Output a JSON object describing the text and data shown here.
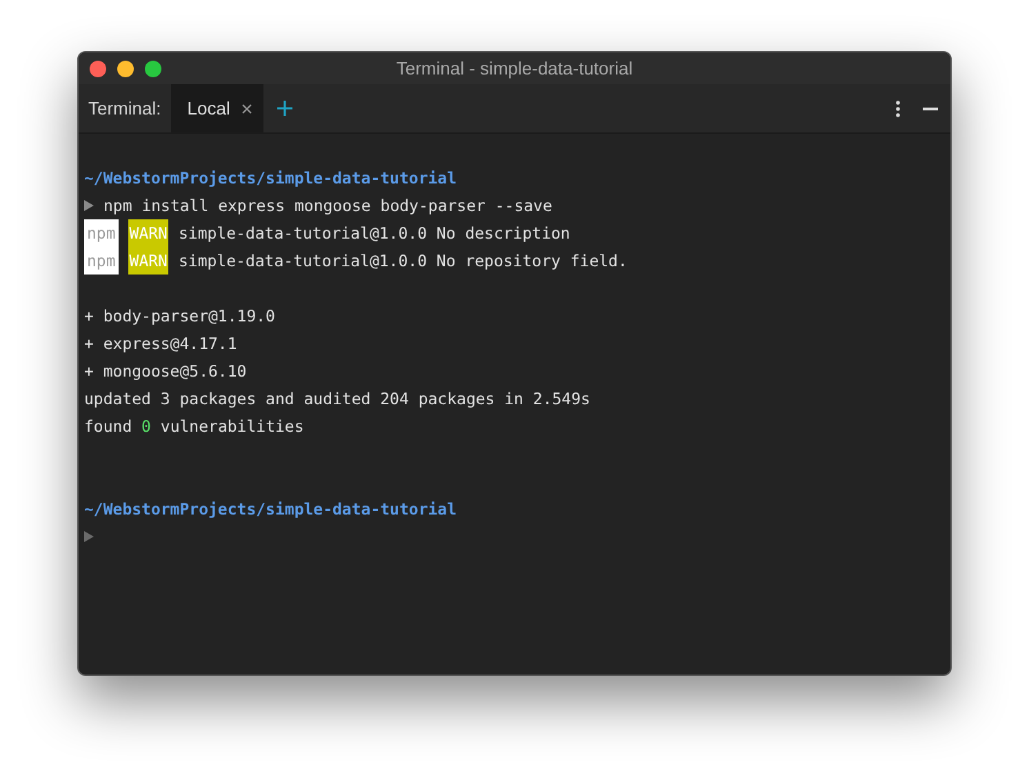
{
  "window": {
    "title": "Terminal - simple-data-tutorial"
  },
  "toolbar": {
    "label": "Terminal:",
    "tabs": [
      {
        "label": "Local",
        "selected": true,
        "closable": true
      }
    ]
  },
  "lines": [
    {
      "kind": "blank"
    },
    {
      "kind": "path",
      "text": "~/WebstormProjects/simple-data-tutorial"
    },
    {
      "kind": "command",
      "text": "npm install express mongoose body-parser --save"
    },
    {
      "kind": "warn",
      "source": "npm",
      "level": "WARN",
      "text": "simple-data-tutorial@1.0.0 No description"
    },
    {
      "kind": "warn",
      "source": "npm",
      "level": "WARN",
      "text": "simple-data-tutorial@1.0.0 No repository field."
    },
    {
      "kind": "blank"
    },
    {
      "kind": "output",
      "parts": [
        {
          "text": "+ body-parser@1.19.0",
          "highlight": false
        }
      ]
    },
    {
      "kind": "output",
      "parts": [
        {
          "text": "+ express@4.17.1",
          "highlight": false
        }
      ]
    },
    {
      "kind": "output",
      "parts": [
        {
          "text": "+ mongoose@5.6.10",
          "highlight": false
        }
      ]
    },
    {
      "kind": "output",
      "parts": [
        {
          "text": "updated 3 packages and audited 204 packages in 2.549s",
          "highlight": false
        }
      ]
    },
    {
      "kind": "output",
      "parts": [
        {
          "text": "found ",
          "highlight": false
        },
        {
          "text": "0",
          "highlight": true
        },
        {
          "text": " vulnerabilities",
          "highlight": false
        }
      ]
    },
    {
      "kind": "blank"
    },
    {
      "kind": "blank"
    },
    {
      "kind": "path",
      "text": "~/WebstormProjects/simple-data-tutorial"
    },
    {
      "kind": "prompt"
    }
  ]
}
